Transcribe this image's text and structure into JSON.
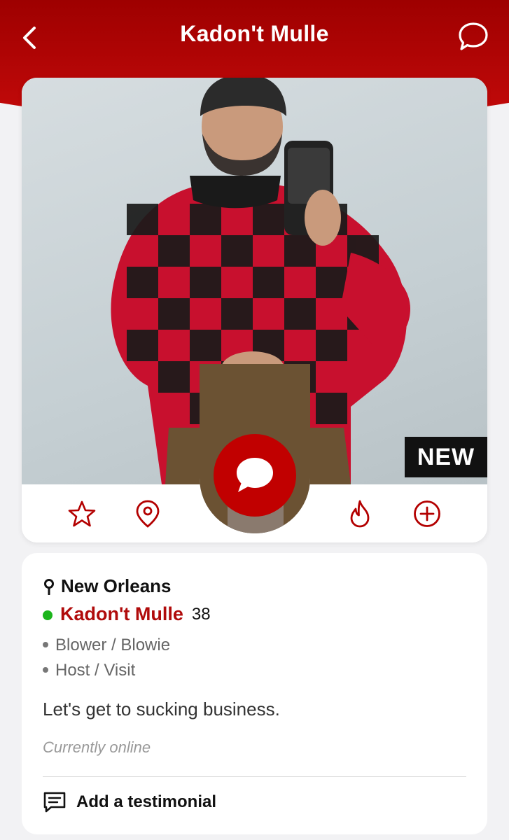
{
  "header": {
    "title": "Kadon't Mulle",
    "back_icon": "chevron-left-icon",
    "chat_icon": "chat-bubble-icon"
  },
  "profile": {
    "badge": "NEW",
    "location": "New Orleans",
    "name": "Kadon't Mulle",
    "age": "38",
    "tags": [
      "Blower / Blowie",
      "Host / Visit"
    ],
    "bio": "Let's get to sucking business.",
    "status": "Currently online",
    "online": true
  },
  "actions": {
    "favorite_icon": "star-icon",
    "map_icon": "map-pin-icon",
    "fire_icon": "flame-icon",
    "add_icon": "plus-circle-icon",
    "message_icon": "message-bubble-icon"
  },
  "testimonial": {
    "label": "Add a testimonial",
    "icon": "comment-lines-icon"
  },
  "colors": {
    "brand": "#c10000",
    "header_dark": "#9e0000",
    "name": "#b00b0b",
    "online": "#1cb51c"
  }
}
